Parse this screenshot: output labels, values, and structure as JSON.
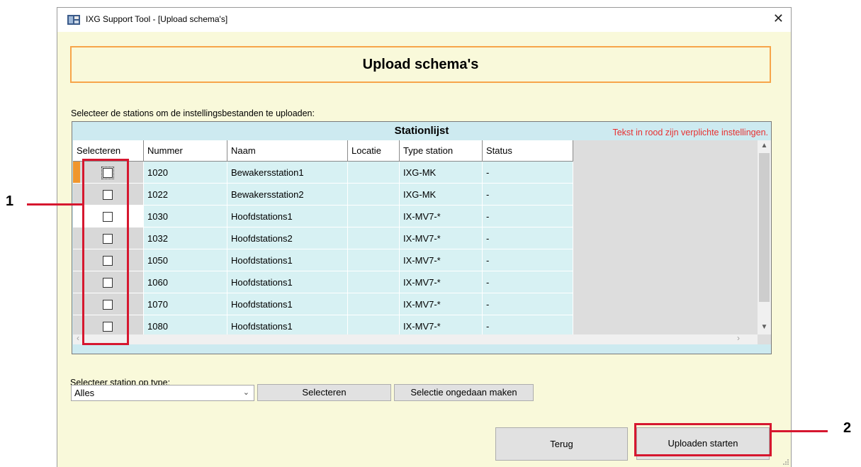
{
  "window": {
    "title": "IXG Support Tool - [Upload schema's]",
    "close_symbol": "✕"
  },
  "header": {
    "title": "Upload schema's"
  },
  "instruction": "Selecteer de stations om de instellingsbestanden te uploaden:",
  "station_list": {
    "title": "Stationlijst",
    "required_note": "Tekst in rood zijn verplichte instellingen.",
    "columns": [
      "Selecteren",
      "Nummer",
      "Naam",
      "Locatie",
      "Type station",
      "Status"
    ],
    "rows": [
      {
        "selected": false,
        "number": "1020",
        "name": "Bewakersstation1",
        "location": "",
        "type": "IXG-MK",
        "status": "-"
      },
      {
        "selected": false,
        "number": "1022",
        "name": "Bewakersstation2",
        "location": "",
        "type": "IXG-MK",
        "status": "-"
      },
      {
        "selected": false,
        "number": "1030",
        "name": "Hoofdstations1",
        "location": "",
        "type": "IX-MV7-*",
        "status": "-"
      },
      {
        "selected": false,
        "number": "1032",
        "name": "Hoofdstations2",
        "location": "",
        "type": "IX-MV7-*",
        "status": "-"
      },
      {
        "selected": false,
        "number": "1050",
        "name": "Hoofdstations1",
        "location": "",
        "type": "IX-MV7-*",
        "status": "-"
      },
      {
        "selected": false,
        "number": "1060",
        "name": "Hoofdstations1",
        "location": "",
        "type": "IX-MV7-*",
        "status": "-"
      },
      {
        "selected": false,
        "number": "1070",
        "name": "Hoofdstations1",
        "location": "",
        "type": "IX-MV7-*",
        "status": "-"
      },
      {
        "selected": false,
        "number": "1080",
        "name": "Hoofdstations1",
        "location": "",
        "type": "IX-MV7-*",
        "status": "-"
      }
    ]
  },
  "filter": {
    "label": "Selecteer station op type:",
    "selected_type": "Alles",
    "select_button": "Selecteren",
    "deselect_button": "Selectie ongedaan maken"
  },
  "footer": {
    "back_button": "Terug",
    "start_button": "Uploaden starten"
  },
  "callouts": [
    "1",
    "2"
  ],
  "colors": {
    "accent_orange": "#f7a54a",
    "callout_red": "#d6172f",
    "required_red": "#e83030",
    "grid_cyan": "#d7f1f3"
  }
}
